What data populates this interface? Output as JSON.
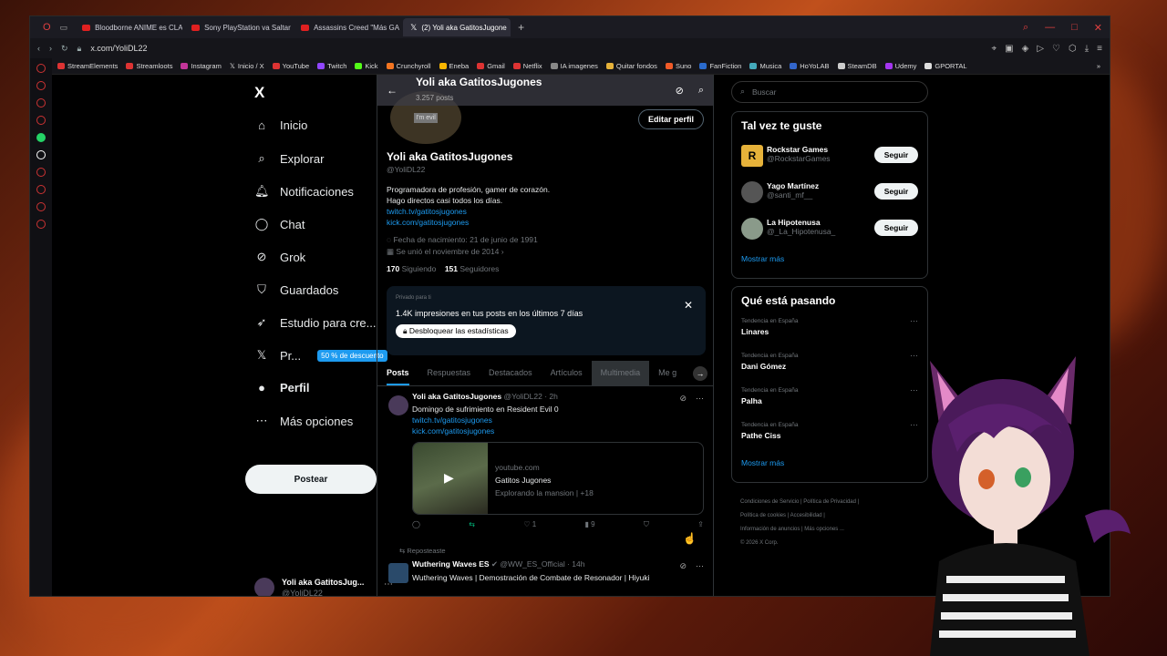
{
  "browser": {
    "tabs": [
      {
        "label": "Bloodborne ANIME es CLA"
      },
      {
        "label": "Sony PlayStation va Saltar"
      },
      {
        "label": "Assassins Creed \"Más GA"
      },
      {
        "label": "(2) Yoli aka GatitosJugone",
        "active": true
      }
    ],
    "url": "x.com/YoliDL22",
    "bookmarks": [
      "StreamElements",
      "Streamloots",
      "Instagram",
      "Inicio / X",
      "YouTube",
      "Twitch",
      "Kick",
      "Crunchyroll",
      "Eneba",
      "Gmail",
      "Netflix",
      "IA imagenes",
      "Quitar fondos",
      "Suno",
      "FanFiction",
      "Musica",
      "HoYoLAB",
      "SteamDB",
      "Udemy",
      "GPORTAL"
    ]
  },
  "nav": {
    "logo": "X",
    "items": [
      {
        "label": "Inicio",
        "icon": "home-icon"
      },
      {
        "label": "Explorar",
        "icon": "search-icon"
      },
      {
        "label": "Notificaciones",
        "icon": "bell-icon"
      },
      {
        "label": "Chat",
        "icon": "chat-icon"
      },
      {
        "label": "Grok",
        "icon": "grok-icon"
      },
      {
        "label": "Guardados",
        "icon": "bookmark-icon"
      },
      {
        "label": "Estudio para cre...",
        "icon": "rocket-icon"
      },
      {
        "label": "Pr...",
        "icon": "x-icon"
      },
      {
        "label": "Perfil",
        "icon": "person-icon"
      },
      {
        "label": "Más opciones",
        "icon": "more-icon"
      }
    ],
    "premium_badge": "50 % de descuento",
    "post_button": "Postear",
    "account": {
      "name": "Yoli aka GatitosJug...",
      "handle": "@YoliDL22"
    }
  },
  "profile": {
    "header_name": "Yoli aka GatitosJugones",
    "posts_count": "3.257 posts",
    "edit_button": "Editar perfil",
    "name": "Yoli aka GatitosJugones",
    "handle": "@YoliDL22",
    "bio_line1": "Programadora de profesión, gamer de corazón.",
    "bio_line2": "Hago directos casi todos los días.",
    "link1": "twitch.tv/gatitosjugones",
    "link2": "kick.com/gatitosjugones",
    "birthday": "Fecha de nacimiento: 21 de junio de 1991",
    "joined": "Se unió el noviembre de 2014",
    "following_count": "170",
    "following_label": "Siguiendo",
    "followers_count": "151",
    "followers_label": "Seguidores",
    "stats": {
      "private": "Privado para ti",
      "impressions": "1.4K impresiones en tus posts en los últimos 7 días",
      "unlock": "Desbloquear las estadísticas"
    },
    "tabs": [
      "Posts",
      "Respuestas",
      "Destacados",
      "Artículos",
      "Multimedia",
      "Me g"
    ]
  },
  "tweet1": {
    "name": "Yoli aka GatitosJugones",
    "handle": "@YoliDL22",
    "time": "· 2h",
    "text": "Domingo de sufrimiento en Resident Evil 0",
    "link1": "twitch.tv/gatitosjugones",
    "link2": "kick.com/gatitosjugones",
    "card": {
      "domain": "youtube.com",
      "title": "Gatitos Jugones",
      "desc": "Explorando la mansion | +18"
    },
    "reposts": "1",
    "views": "9"
  },
  "repost_label": "Reposteaste",
  "tweet2": {
    "name": "Wuthering Waves ES",
    "handle": "@WW_ES_Official",
    "time": "· 14h",
    "text": "Wuthering Waves | Demostración de Combate de Resonador | Hiyuki"
  },
  "right": {
    "search_placeholder": "Buscar",
    "wtf_title": "Tal vez te guste",
    "wtf": [
      {
        "name": "Rockstar Games",
        "handle": "@RockstarGames"
      },
      {
        "name": "Yago Martínez",
        "handle": "@santi_mf__"
      },
      {
        "name": "La Hipotenusa",
        "handle": "@_La_Hipotenusa_"
      }
    ],
    "follow_label": "Seguir",
    "show_more": "Mostrar más",
    "trends_title": "Qué está pasando",
    "trends": [
      {
        "context": "Tendencia en España",
        "name": "Linares"
      },
      {
        "context": "Tendencia en España",
        "name": "Dani Gómez"
      },
      {
        "context": "Tendencia en España",
        "name": "Palha"
      },
      {
        "context": "Tendencia en España",
        "name": "Pathe Ciss"
      }
    ],
    "footer": [
      "Condiciones de Servicio",
      "Política de Privacidad",
      "Política de cookies",
      "Accesibilidad",
      "Información de anuncios",
      "Más opciones ...",
      "© 2026 X Corp."
    ]
  }
}
